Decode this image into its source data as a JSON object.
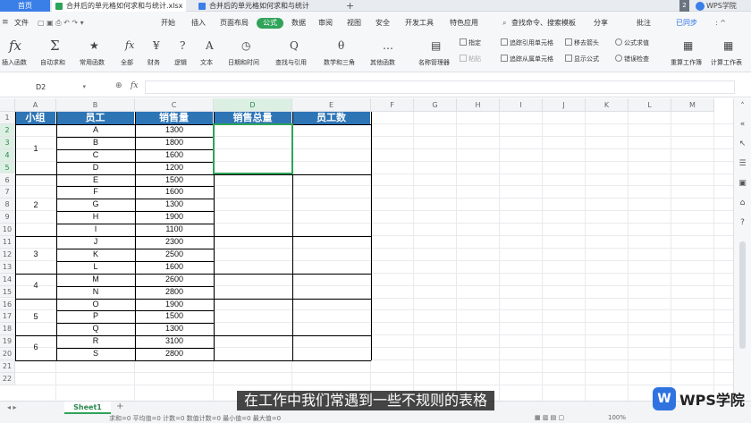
{
  "titlebar": {
    "home_tab": "首页",
    "tabs": [
      {
        "label": "合并后的单元格如何求和与统计.xlsx",
        "active": true
      },
      {
        "label": "合并后的单元格如何求和与统计",
        "active": false
      }
    ],
    "badge": "2",
    "brand": "WPS学院"
  },
  "menubar": {
    "file": "文件",
    "items": [
      "开始",
      "插入",
      "页面布局",
      "公式",
      "数据",
      "审阅",
      "视图",
      "安全",
      "开发工具",
      "特色应用"
    ],
    "active": "公式",
    "search": "查找命令、搜索模板",
    "share": "分享",
    "comment": "批注",
    "sync": "已同步"
  },
  "ribbon": {
    "buttons": [
      {
        "icon": "fx",
        "label": "插入函数"
      },
      {
        "icon": "Σ",
        "label": "自动求和"
      },
      {
        "icon": "★",
        "label": "常用函数"
      },
      {
        "icon": "fx",
        "label": "全部"
      },
      {
        "icon": "¥",
        "label": "财务"
      },
      {
        "icon": "?",
        "label": "逻辑"
      },
      {
        "icon": "A",
        "label": "文本"
      },
      {
        "icon": "◷",
        "label": "日期和时间"
      },
      {
        "icon": "Q",
        "label": "查找与引用"
      },
      {
        "icon": "θ",
        "label": "数学和三角"
      },
      {
        "icon": "…",
        "label": "其他函数"
      },
      {
        "icon": "▤",
        "label": "名称管理器"
      }
    ],
    "small": [
      "指定",
      "粘贴",
      "追踪引用单元格",
      "追踪从属单元格",
      "移去箭头",
      "显示公式",
      "公式求值",
      "错误检查"
    ],
    "right_buttons": [
      {
        "icon": "▦",
        "label": "重算工作簿"
      },
      {
        "icon": "▦",
        "label": "计算工作表"
      }
    ]
  },
  "formula_bar": {
    "cell_ref": "D2",
    "fx": "fx",
    "value": ""
  },
  "sheet": {
    "columns": [
      "A",
      "B",
      "C",
      "D",
      "E",
      "F",
      "G",
      "H",
      "I",
      "J",
      "K",
      "L",
      "M"
    ],
    "rows": [
      "1",
      "2",
      "3",
      "4",
      "5",
      "6",
      "7",
      "8",
      "9",
      "10",
      "11",
      "12",
      "13",
      "14",
      "15",
      "16",
      "17",
      "18",
      "19",
      "20",
      "21",
      "22"
    ],
    "headers": [
      "小组",
      "员工",
      "销售量",
      "销售总量",
      "员工数"
    ],
    "groups": [
      {
        "name": "1",
        "employees": [
          {
            "name": "A",
            "sales": "1300"
          },
          {
            "name": "B",
            "sales": "1800"
          },
          {
            "name": "C",
            "sales": "1600"
          },
          {
            "name": "D",
            "sales": "1200"
          }
        ]
      },
      {
        "name": "2",
        "employees": [
          {
            "name": "E",
            "sales": "1500"
          },
          {
            "name": "F",
            "sales": "1600"
          },
          {
            "name": "G",
            "sales": "1300"
          },
          {
            "name": "H",
            "sales": "1900"
          },
          {
            "name": "I",
            "sales": "1100"
          }
        ]
      },
      {
        "name": "3",
        "employees": [
          {
            "name": "J",
            "sales": "2300"
          },
          {
            "name": "K",
            "sales": "2500"
          },
          {
            "name": "L",
            "sales": "1600"
          }
        ]
      },
      {
        "name": "4",
        "employees": [
          {
            "name": "M",
            "sales": "2600"
          },
          {
            "name": "N",
            "sales": "2800"
          }
        ]
      },
      {
        "name": "5",
        "employees": [
          {
            "name": "O",
            "sales": "1900"
          },
          {
            "name": "P",
            "sales": "1500"
          },
          {
            "name": "Q",
            "sales": "1300"
          }
        ]
      },
      {
        "name": "6",
        "employees": [
          {
            "name": "R",
            "sales": "3100"
          },
          {
            "name": "S",
            "sales": "2800"
          }
        ]
      }
    ],
    "tab_name": "Sheet1"
  },
  "status": "求和=0   平均值=0   计数=0   数值计数=0   最小值=0   最大值=0",
  "zoom": "100%",
  "subtitle": "在工作中我们常遇到一些不规则的表格",
  "logo": {
    "mark": "W",
    "text": "WPS学院"
  },
  "colors": {
    "header_blue": "#2e75b6",
    "accent_green": "#2fa35a",
    "wps_blue": "#2f73e0"
  }
}
